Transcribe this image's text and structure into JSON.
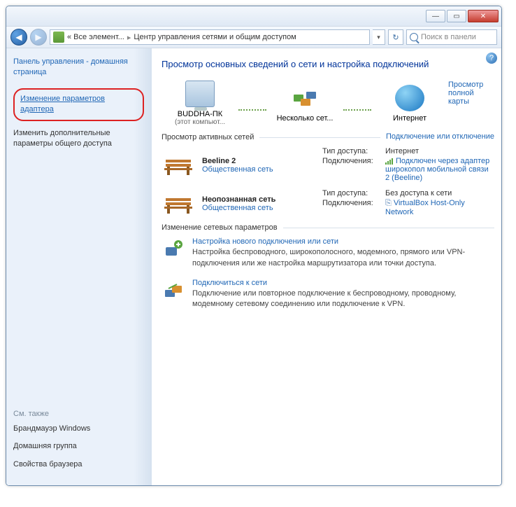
{
  "titlebar": {
    "min": "—",
    "max": "▭",
    "close": "✕"
  },
  "addressbar": {
    "back": "◀",
    "fwd": "▶",
    "crumb1": "« Все элемент...",
    "crumb2": "Центр управления сетями и общим доступом",
    "refresh": "↻",
    "search_placeholder": "Поиск в панели"
  },
  "sidebar": {
    "home": "Панель управления - домашняя страница",
    "link1": "Изменение параметров адаптера",
    "link2": "Изменить дополнительные параметры общего доступа",
    "see_also": "См. также",
    "sa1": "Брандмауэр Windows",
    "sa2": "Домашняя группа",
    "sa3": "Свойства браузера"
  },
  "main": {
    "help": "?",
    "title": "Просмотр основных сведений о сети и настройка подключений",
    "full_map": "Просмотр полной карты",
    "node1": "BUDDHA-ПК",
    "node1_sub": "(этот компьют...",
    "node2": "Несколько сет...",
    "node3": "Интернет",
    "active_label": "Просмотр активных сетей",
    "connect_link": "Подключение или отключение",
    "net1": {
      "name": "Beeline 2",
      "type": "Общественная сеть",
      "access_label": "Тип доступа:",
      "access_val": "Интернет",
      "conn_label": "Подключения:",
      "conn_val": "Подключен через адаптер широкопол мобильной связи 2 (Beeline)"
    },
    "net2": {
      "name": "Неопознанная сеть",
      "type": "Общественная сеть",
      "access_label": "Тип доступа:",
      "access_val": "Без доступа к сети",
      "conn_label": "Подключения:",
      "conn_val": "VirtualBox Host-Only Network"
    },
    "settings_label": "Изменение сетевых параметров",
    "s1_title": "Настройка нового подключения или сети",
    "s1_desc": "Настройка беспроводного, широкополосного, модемного, прямого или VPN-подключения или же настройка маршрутизатора или точки доступа.",
    "s2_title": "Подключиться к сети",
    "s2_desc": "Подключение или повторное подключение к беспроводному, проводному, модемному сетевому соединению или подключение к VPN."
  }
}
